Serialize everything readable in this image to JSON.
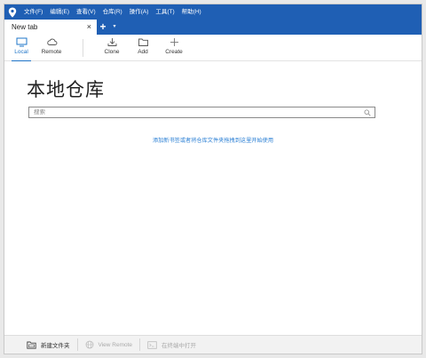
{
  "menu": {
    "items": [
      "文件(F)",
      "编辑(E)",
      "查看(V)",
      "仓库(R)",
      "操作(A)",
      "工具(T)",
      "帮助(H)"
    ]
  },
  "tabs": {
    "active_title": "New tab",
    "close_glyph": "×",
    "add_glyph": "+",
    "menu_glyph": "▾"
  },
  "toolbar": {
    "local_label": "Local",
    "remote_label": "Remote",
    "clone_label": "Clone",
    "add_label": "Add",
    "create_label": "Create"
  },
  "main": {
    "title": "本地仓库",
    "search_placeholder": "搜索",
    "hint_text": "添加新书签或者将仓库文件夹拖拽到这里开始使用"
  },
  "bottombar": {
    "new_folder_label": "新建文件夹",
    "view_remote_label": "View Remote",
    "open_terminal_label": "在终端中打开"
  },
  "colors": {
    "titlebar": "#1f5fb4",
    "accent": "#1e74c8",
    "link": "#2a7fd4"
  }
}
